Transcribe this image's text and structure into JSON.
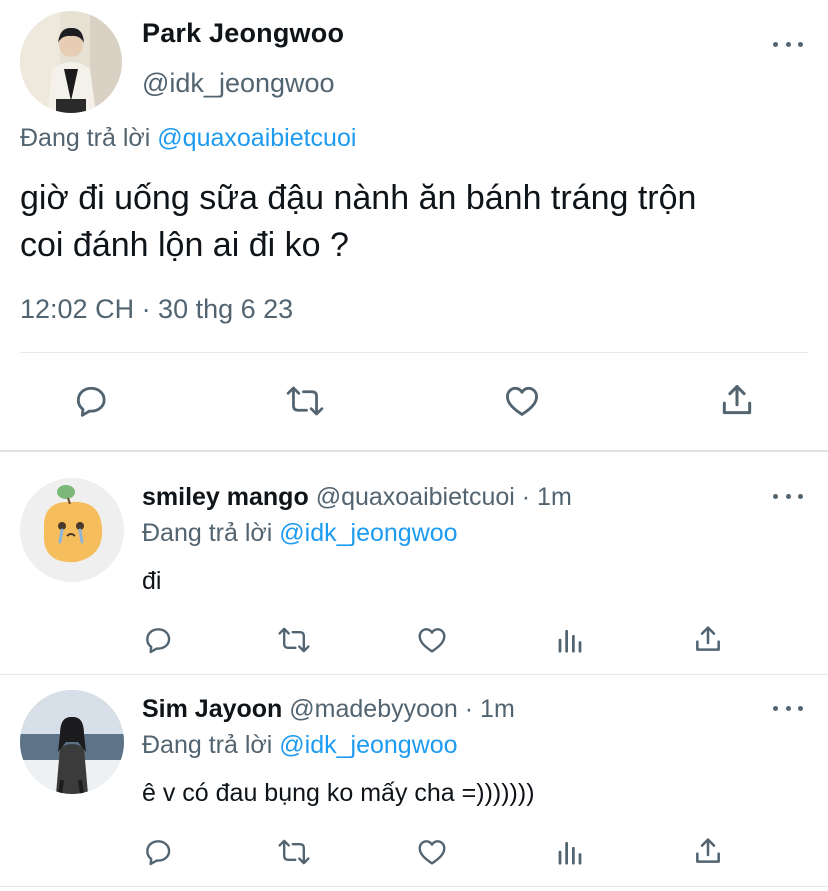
{
  "main_tweet": {
    "display_name": "Park Jeongwoo",
    "handle": "@idk_jeongwoo",
    "replying_prefix": "Đang trả lời",
    "replying_to": "@quaxoaibietcuoi",
    "text_line1": "giờ đi uống sữa đậu nành ăn bánh tráng trộn",
    "text_line2": "coi đánh lộn ai đi ko ?",
    "timestamp": "12:02 CH · 30 thg 6 23"
  },
  "action_icons": [
    "reply-icon",
    "retweet-icon",
    "like-icon",
    "share-icon"
  ],
  "reply_action_icons": [
    "reply-icon",
    "retweet-icon",
    "like-icon",
    "analytics-icon",
    "share-icon"
  ],
  "replies": [
    {
      "display_name": "smiley mango",
      "handle": "@quaxoaibietcuoi",
      "time": "· 1m",
      "replying_prefix": "Đang trả lời",
      "replying_to": "@idk_jeongwoo",
      "text": "đi"
    },
    {
      "display_name": "Sim Jayoon",
      "handle": "@madebyyoon",
      "time": "· 1m",
      "replying_prefix": "Đang trả lời",
      "replying_to": "@idk_jeongwoo",
      "text": "ê v có đau bụng ko mấy cha =)))))))"
    }
  ],
  "colors": {
    "text_primary": "#0f1419",
    "text_secondary": "#536471",
    "link": "#1d9bf0",
    "divider": "#e6e9ec"
  }
}
